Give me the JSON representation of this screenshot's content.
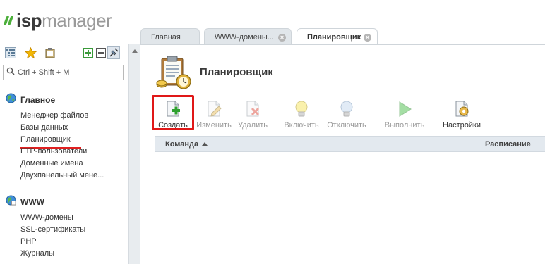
{
  "app": {
    "logo_bold": "isp",
    "logo_light": "manager"
  },
  "sidebar": {
    "search_placeholder": "Ctrl + Shift + M",
    "sections": [
      {
        "title": "Главное",
        "items": [
          "Менеджер файлов",
          "Базы данных",
          "Планировщик",
          "FTP-пользователи",
          "Доменные имена",
          "Двухпанельный мене..."
        ]
      },
      {
        "title": "WWW",
        "items": [
          "WWW-домены",
          "SSL-сертификаты",
          "PHP",
          "Журналы"
        ]
      }
    ],
    "active_item": "Планировщик"
  },
  "tabs": [
    {
      "label": "Главная",
      "closable": false,
      "active": false
    },
    {
      "label": "WWW-домены...",
      "closable": true,
      "active": false
    },
    {
      "label": "Планировщик",
      "closable": true,
      "active": true
    }
  ],
  "page": {
    "title": "Планировщик"
  },
  "toolbar": {
    "create": "Создать",
    "edit": "Изменить",
    "delete": "Удалить",
    "enable": "Включить",
    "disable": "Отключить",
    "run": "Выполнить",
    "settings": "Настройки"
  },
  "table": {
    "columns": [
      "Команда",
      "Расписание"
    ],
    "sort_column": "Команда",
    "sort_direction": "ascending",
    "rows": []
  },
  "colors": {
    "highlight": "#e01818",
    "accent_green": "#4caf3a",
    "header_bg": "#e3e9ef"
  }
}
